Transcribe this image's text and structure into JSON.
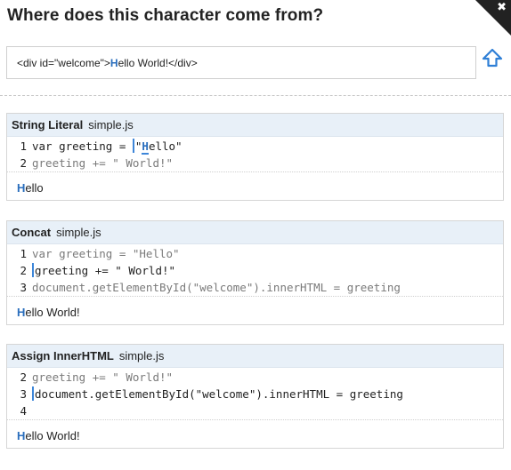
{
  "header": {
    "title": "Where does this character come from?",
    "close_glyph": "✖"
  },
  "html_preview": {
    "before": "<div id=\"welcome\">",
    "highlight": "H",
    "after": "ello World!</div>",
    "up_icon": "up-arrow-icon"
  },
  "steps": [
    {
      "name": "String Literal",
      "file": "simple.js",
      "lines": [
        {
          "num": "1",
          "text": "var greeting = ",
          "hl": "\"",
          "hl2": "H",
          "rest": "ello\""
        },
        {
          "num": "2",
          "text": "greeting += \" World!\""
        }
      ],
      "result_first": "H",
      "result_rest": "ello"
    },
    {
      "name": "Concat",
      "file": "simple.js",
      "lines": [
        {
          "num": "1",
          "text": "var greeting = \"Hello\""
        },
        {
          "num": "2",
          "text": "greeting += \" World!\""
        },
        {
          "num": "3",
          "text": "document.getElementById(\"welcome\").innerHTML = greeting"
        }
      ],
      "result_first": "H",
      "result_rest": "ello World!"
    },
    {
      "name": "Assign InnerHTML",
      "file": "simple.js",
      "lines": [
        {
          "num": "2",
          "text": "greeting += \" World!\""
        },
        {
          "num": "3",
          "text": "document.getElementById(\"welcome\").innerHTML = greeting"
        },
        {
          "num": "4",
          "text": ""
        }
      ],
      "result_first": "H",
      "result_rest": "ello World!"
    }
  ],
  "colors": {
    "accent": "#3d86d9",
    "header_bg": "#e8f0f8"
  }
}
